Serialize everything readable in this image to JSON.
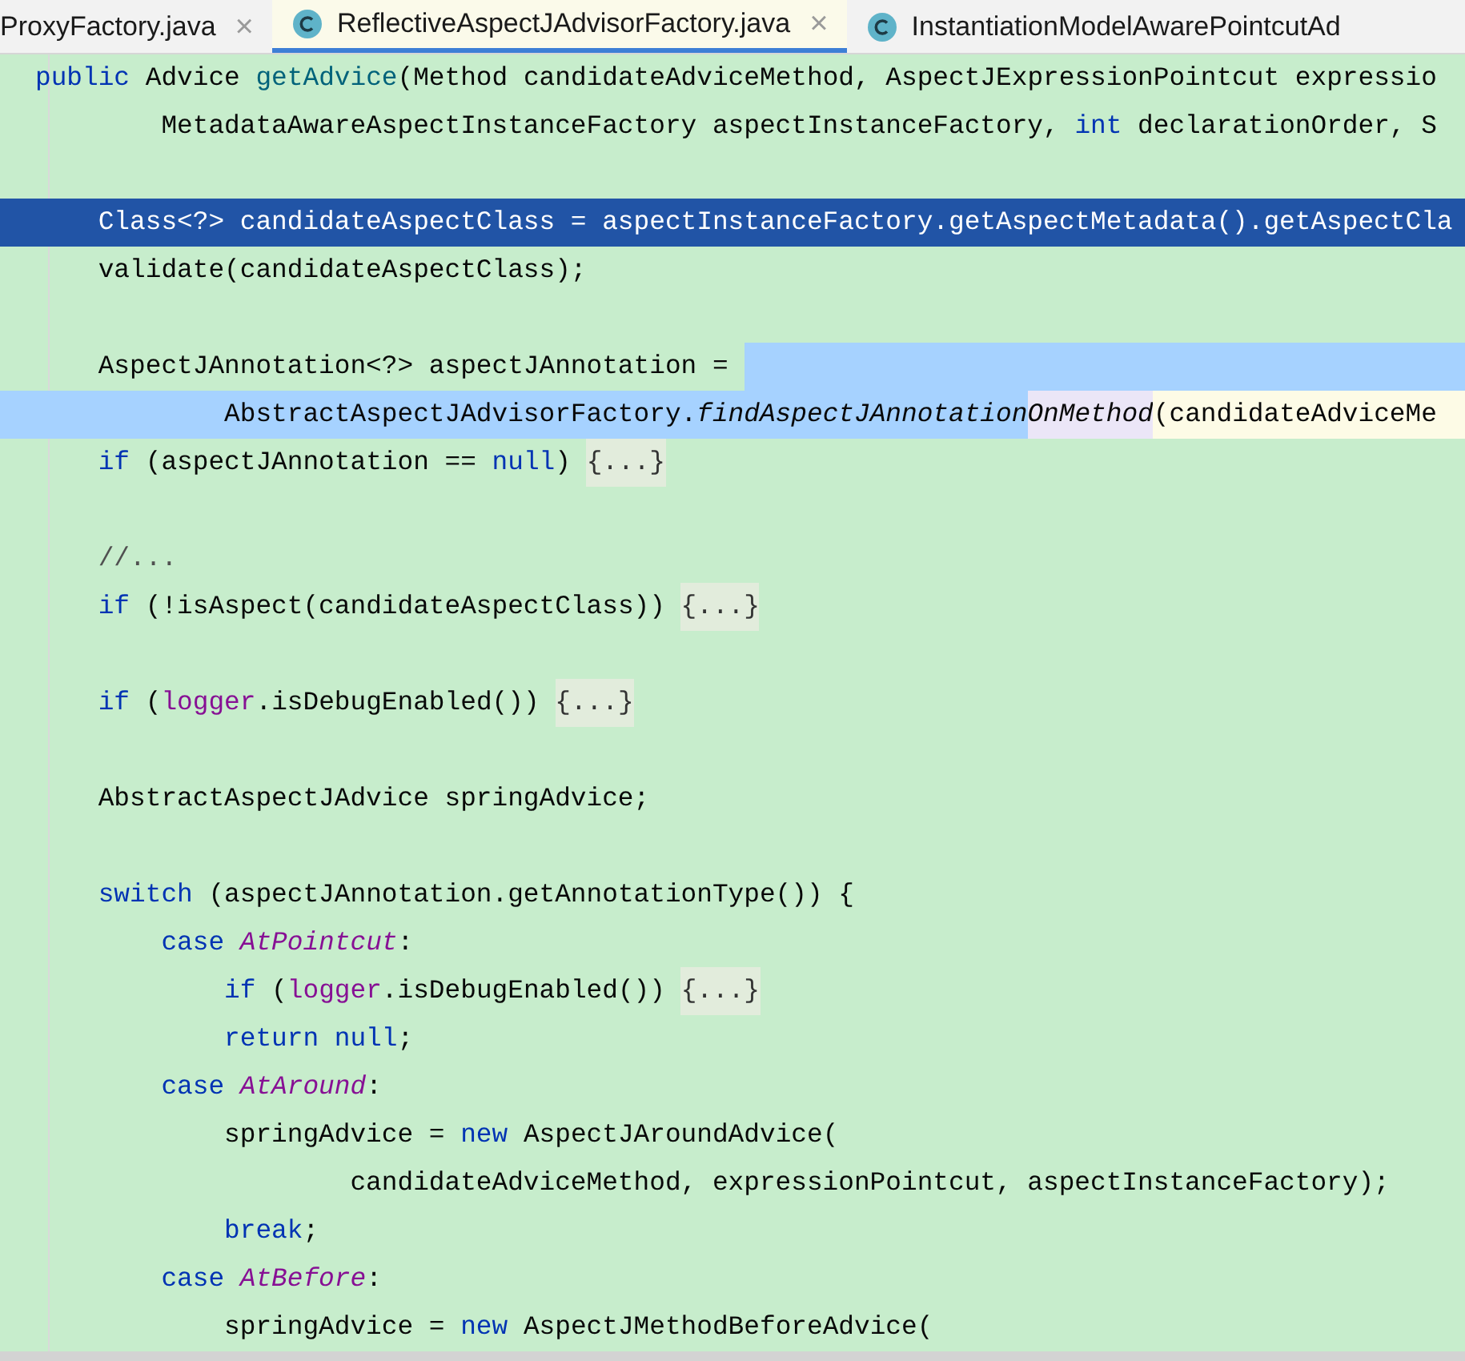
{
  "tabs": [
    {
      "label": "ProxyFactory.java",
      "icon": false,
      "close": "×",
      "selected": false
    },
    {
      "label": "ReflectiveAspectJAdvisorFactory.java",
      "icon": true,
      "close": "×",
      "selected": true
    },
    {
      "label": "InstantiationModelAwarePointcutAd",
      "icon": true,
      "selected": false
    }
  ],
  "lines": [
    {
      "tokens": [
        {
          "t": "public ",
          "kind": "kw"
        },
        {
          "t": "Advice "
        },
        {
          "t": "getAdvice",
          "kind": "method"
        },
        {
          "t": "(Method candidateAdviceMethod, AspectJExpressionPointcut expressio"
        }
      ]
    },
    {
      "tokens": [
        {
          "t": "        MetadataAwareAspectInstanceFactory aspectInstanceFactory, "
        },
        {
          "t": "int ",
          "kind": "kw"
        },
        {
          "t": "declarationOrder, S"
        }
      ]
    },
    {
      "kind": "blank"
    },
    {
      "current": true,
      "tokens": [
        {
          "t": "    Class<?> candidateAspectClass = aspectInstanceFactory.getAspectMetadata().getAspectCla"
        }
      ]
    },
    {
      "tokens": [
        {
          "t": "    validate(candidateAspectClass);"
        }
      ]
    },
    {
      "kind": "blank"
    },
    {
      "selected_to_end": true,
      "tokens": [
        {
          "t": "    AspectJAnnotation<?> aspectJAnnotation = "
        }
      ]
    },
    {
      "gutter_selected": true,
      "tokens": [
        {
          "t": "            AbstractAspectJAdvisorFactory.",
          "selected": true
        },
        {
          "t": "findAspectJAnnotation",
          "kind": "static",
          "selected": true
        },
        {
          "t": "OnMethod",
          "kind": "static",
          "selected": false,
          "match": true
        },
        {
          "t": "(candidateAdviceMe",
          "selected": false
        }
      ]
    },
    {
      "tokens": [
        {
          "t": "    if ",
          "kind": "kw"
        },
        {
          "t": "(aspectJAnnotation == "
        },
        {
          "t": "null",
          "kind": "kw"
        },
        {
          "t": ") "
        },
        {
          "t": "{...}",
          "kind": "fold"
        }
      ]
    },
    {
      "kind": "blank"
    },
    {
      "tokens": [
        {
          "t": "    //...",
          "kind": "comment"
        }
      ]
    },
    {
      "tokens": [
        {
          "t": "    if ",
          "kind": "kw"
        },
        {
          "t": "(!isAspect(candidateAspectClass)) "
        },
        {
          "t": "{...}",
          "kind": "fold"
        }
      ]
    },
    {
      "kind": "blank"
    },
    {
      "tokens": [
        {
          "t": "    if ",
          "kind": "kw"
        },
        {
          "t": "("
        },
        {
          "t": "logger",
          "kind": "field"
        },
        {
          "t": ".isDebugEnabled()) "
        },
        {
          "t": "{...}",
          "kind": "fold"
        }
      ]
    },
    {
      "kind": "blank"
    },
    {
      "tokens": [
        {
          "t": "    AbstractAspectJAdvice springAdvice;"
        }
      ]
    },
    {
      "kind": "blank"
    },
    {
      "tokens": [
        {
          "t": "    switch ",
          "kind": "kw"
        },
        {
          "t": "(aspectJAnnotation.getAnnotationType()) {"
        }
      ]
    },
    {
      "tokens": [
        {
          "t": "        case ",
          "kind": "kw"
        },
        {
          "t": "AtPointcut",
          "kind": "const"
        },
        {
          "t": ":"
        }
      ]
    },
    {
      "tokens": [
        {
          "t": "            if ",
          "kind": "kw"
        },
        {
          "t": "("
        },
        {
          "t": "logger",
          "kind": "field"
        },
        {
          "t": ".isDebugEnabled()) "
        },
        {
          "t": "{...}",
          "kind": "fold"
        }
      ]
    },
    {
      "tokens": [
        {
          "t": "            return null",
          "kind": "kw"
        },
        {
          "t": ";"
        }
      ]
    },
    {
      "tokens": [
        {
          "t": "        case ",
          "kind": "kw"
        },
        {
          "t": "AtAround",
          "kind": "const"
        },
        {
          "t": ":"
        }
      ]
    },
    {
      "tokens": [
        {
          "t": "            springAdvice = "
        },
        {
          "t": "new ",
          "kind": "kw"
        },
        {
          "t": "AspectJAroundAdvice("
        }
      ]
    },
    {
      "tokens": [
        {
          "t": "                    candidateAdviceMethod, expressionPointcut, aspectInstanceFactory);"
        }
      ]
    },
    {
      "tokens": [
        {
          "t": "            break",
          "kind": "kw"
        },
        {
          "t": ";"
        }
      ]
    },
    {
      "tokens": [
        {
          "t": "        case ",
          "kind": "kw"
        },
        {
          "t": "AtBefore",
          "kind": "const"
        },
        {
          "t": ":"
        }
      ]
    },
    {
      "tokens": [
        {
          "t": "            springAdvice = "
        },
        {
          "t": "new ",
          "kind": "kw"
        },
        {
          "t": "AspectJMethodBeforeAdvice("
        }
      ]
    }
  ]
}
